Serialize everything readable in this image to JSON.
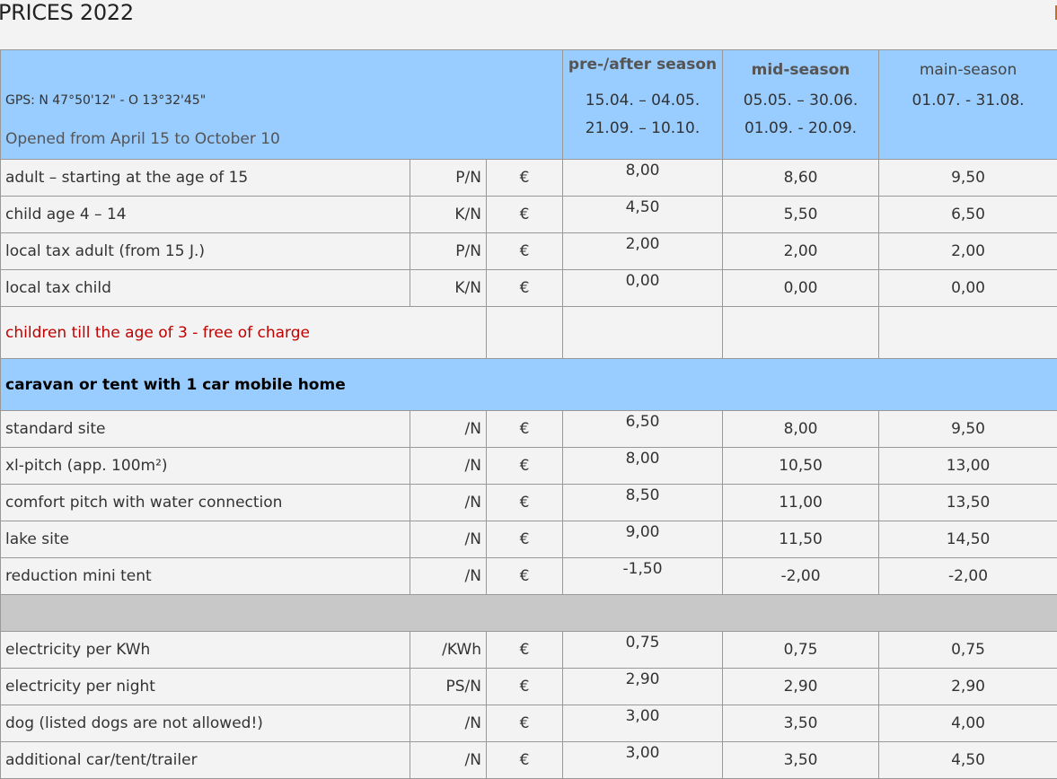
{
  "page": {
    "title": "PRICES 2022",
    "accent_color": "#99ccff",
    "note_color": "#c00000"
  },
  "header": {
    "gps": "GPS: N 47°50'12\" - O 13°32'45\"",
    "opened": "Opened from April 15 to October 10",
    "seasons": [
      {
        "name": "pre-/after season",
        "dates1": "15.04. – 04.05.",
        "dates2": "21.09. – 10.10."
      },
      {
        "name": "mid-season",
        "dates1": "05.05. – 30.06.",
        "dates2": "01.09. - 20.09."
      },
      {
        "name": "main-season",
        "dates1": "01.07. - 31.08.",
        "dates2": ""
      }
    ]
  },
  "persons": [
    {
      "label": "adult – starting at the age of 15",
      "unit": "P/N",
      "currency": "€",
      "pre": "8,00",
      "mid": "8,60",
      "main": "9,50"
    },
    {
      "label": "child  age 4 – 14",
      "unit": "K/N",
      "currency": "€",
      "pre": "4,50",
      "mid": "5,50",
      "main": "6,50"
    },
    {
      "label": "local tax adult (from 15 J.)",
      "unit": "P/N",
      "currency": "€",
      "pre": "2,00",
      "mid": "2,00",
      "main": "2,00"
    },
    {
      "label": "local tax child",
      "unit": "K/N",
      "currency": "€",
      "pre": "0,00",
      "mid": "0,00",
      "main": "0,00"
    }
  ],
  "free_note": "children till the age of 3 - free of charge",
  "section_title": "caravan or tent with 1 car mobile home",
  "pitches": [
    {
      "label": "standard site",
      "unit": "/N",
      "currency": "€",
      "pre": "6,50",
      "mid": "8,00",
      "main": "9,50"
    },
    {
      "label": "xl-pitch (app. 100m²)",
      "unit": "/N",
      "currency": "€",
      "pre": "8,00",
      "mid": "10,50",
      "main": "13,00"
    },
    {
      "label": "comfort pitch with water connection",
      "unit": "/N",
      "currency": "€",
      "pre": "8,50",
      "mid": "11,00",
      "main": "13,50"
    },
    {
      "label": "lake site",
      "unit": "/N",
      "currency": "€",
      "pre": "9,00",
      "mid": "11,50",
      "main": "14,50"
    },
    {
      "label": "reduction mini tent",
      "unit": "/N",
      "currency": "€",
      "pre": "-1,50",
      "mid": "-2,00",
      "main": "-2,00"
    }
  ],
  "extras": [
    {
      "label": "electricity per KWh",
      "unit": "/KWh",
      "currency": "€",
      "pre": "0,75",
      "mid": "0,75",
      "main": "0,75"
    },
    {
      "label": "electricity per night",
      "unit": "PS/N",
      "currency": "€",
      "pre": "2,90",
      "mid": "2,90",
      "main": "2,90"
    },
    {
      "label": "dog (listed dogs are not allowed!)",
      "unit": "/N",
      "currency": "€",
      "pre": "3,00",
      "mid": "3,50",
      "main": "4,00"
    },
    {
      "label": "additional car/tent/trailer",
      "unit": "/N",
      "currency": "€",
      "pre": "3,00",
      "mid": "3,50",
      "main": "4,50"
    }
  ]
}
